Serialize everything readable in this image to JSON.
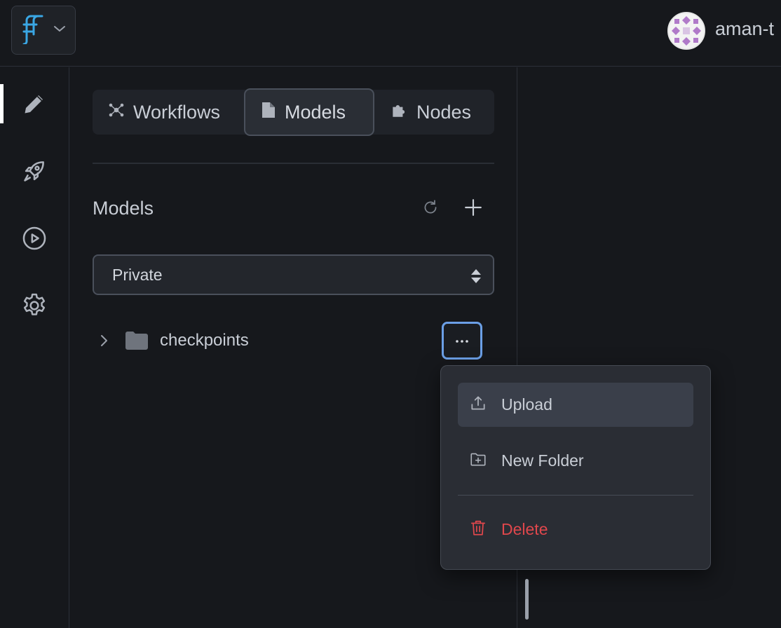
{
  "user": {
    "name": "aman-t"
  },
  "nav": {
    "active": "edit",
    "items": [
      {
        "id": "edit",
        "icon": "pencil-icon"
      },
      {
        "id": "deploy",
        "icon": "rocket-icon"
      },
      {
        "id": "run",
        "icon": "play-circle-icon"
      },
      {
        "id": "settings",
        "icon": "gear-icon"
      }
    ]
  },
  "tabs": [
    {
      "label": "Workflows",
      "icon": "workflow-icon"
    },
    {
      "label": "Models",
      "icon": "file-icon",
      "active": true
    },
    {
      "label": "Nodes",
      "icon": "puzzle-icon"
    }
  ],
  "section": {
    "title": "Models"
  },
  "visibility_select": {
    "value": "Private"
  },
  "tree": [
    {
      "label": "checkpoints",
      "icon": "folder-icon",
      "expanded": false
    }
  ],
  "context_menu": {
    "items": [
      {
        "label": "Upload",
        "icon": "upload-icon"
      },
      {
        "label": "New Folder",
        "icon": "folder-plus-icon"
      },
      {
        "label": "Delete",
        "icon": "trash-icon"
      }
    ]
  },
  "colors": {
    "accent": "#6b9fe6",
    "danger": "#e0474c",
    "logo": "#3aa7e4"
  }
}
